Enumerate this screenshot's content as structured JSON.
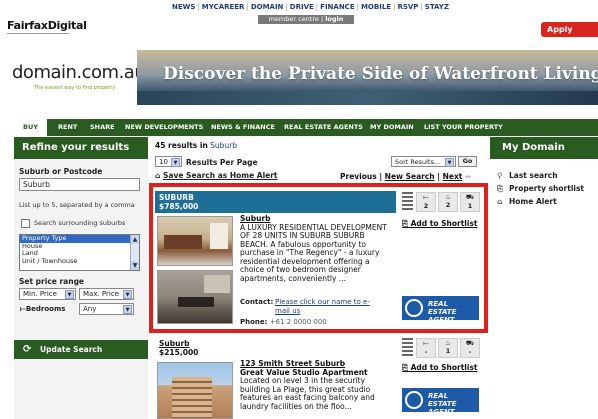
{
  "top": {
    "logo": "FairfaxDigital",
    "nav": [
      "NEWS",
      "MYCAREER",
      "DOMAIN",
      "DRIVE",
      "FINANCE",
      "MOBILE",
      "RSVP",
      "STAYZ"
    ],
    "member_centre": "member centre",
    "login": "login",
    "apply": "Apply online"
  },
  "brand": {
    "logo": "domain.com.au",
    "tagline": "The easiest way to find property",
    "banner_text": "Discover the Private Side of Waterfront Living"
  },
  "main_nav": [
    "BUY",
    "RENT",
    "SHARE",
    "NEW DEVELOPMENTS",
    "NEWS & FINANCE",
    "REAL ESTATE AGENTS",
    "MY DOMAIN",
    "LIST YOUR PROPERTY"
  ],
  "sidebar": {
    "title": "Refine your results",
    "suburb_label": "Suburb or Postcode",
    "suburb_value": "Suburb",
    "hint": "List up to 5, separated by a comma",
    "surrounding": "Search surrounding suburbs",
    "property_types": [
      "Property Type",
      "House",
      "Land",
      "Unit / Townhouse"
    ],
    "price_label": "Set price range",
    "min_price": "Min. Price",
    "max_price": "Max. Price",
    "bedrooms_label": "Bedrooms",
    "bedrooms_value": "Any",
    "update": "Update Search"
  },
  "results": {
    "count_prefix": "45 results in",
    "count_suburb": "Suburb",
    "per_page_value": "10",
    "per_page_label": "Results Per Page",
    "sort_value": "Sort Results...",
    "go": "Go",
    "save_alert": "Save Search as Home Alert",
    "previous": "Previous",
    "new_search": "New Search",
    "next": "Next",
    "listings": [
      {
        "suburb": "SUBURB",
        "price": "$785,000",
        "beds": "2",
        "baths": "2",
        "cars": "1",
        "title": "Suburb",
        "description": "A LUXURY RESIDENTIAL DEVELOPMENT OF 28 UNITS IN SUBURB SUBURB BEACH. A fabulous opportunity to purchase in \"The Regency\" - a luxury residential development offering a choice of two bedroom designer apartments, conveniently ...",
        "shortlist": "Add to Shortlist",
        "contact_label": "Contact:",
        "contact_value": "Please click our name to e-mail us",
        "phone_label": "Phone:",
        "phone_value": "+61 2 0000 000",
        "agent": "REAL ESTATE AGENT"
      },
      {
        "suburb": "Suburb",
        "price": "$215,000",
        "beds": "-",
        "baths": "1",
        "cars": "-",
        "title": "123 Smith Street Suburb",
        "headline": "Great Value Studio Apartment",
        "description": "Located on level 3 in the security building La Plage, this great studio features an east facing balcony and laundry facilities on the floo...",
        "shortlist": "Add to Shortlist",
        "agent": "REAL ESTATE AGENT"
      }
    ]
  },
  "my_domain": {
    "title": "My Domain",
    "links": [
      "Last search",
      "Property shortlist",
      "Home Alert"
    ]
  },
  "colors": {
    "green": "#2a5b20",
    "blue": "#1e6f97",
    "red_highlight": "#e0201b",
    "apply_red": "#d8241c"
  }
}
